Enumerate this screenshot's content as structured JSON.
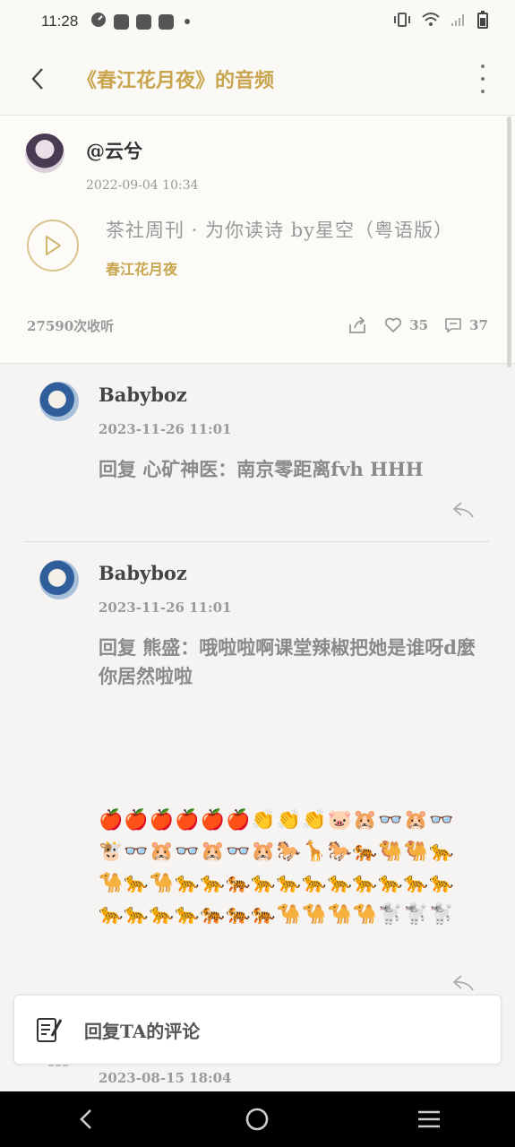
{
  "status_bar": {
    "time": "11:28",
    "icons": [
      "speedometer-icon",
      "mail-icon",
      "mail-icon",
      "mail-icon",
      "dot-icon"
    ],
    "right_icons": [
      "vibrate-icon",
      "wifi-icon",
      "signal-icon",
      "battery-icon"
    ]
  },
  "header": {
    "title": "《春江花月夜》的音频",
    "accent_color": "#c8a54e"
  },
  "post": {
    "user": "@云兮",
    "time": "2022-09-04 10:34",
    "track_title": "茶社周刊 · 为你读诗   by星空（粤语版）",
    "track_sub": "春江花月夜",
    "listen_count": "27590次收听",
    "likes": "35",
    "comments": "37"
  },
  "comments": [
    {
      "user": "Babyboz",
      "time": "2023-11-26 11:01",
      "text": "回复 心矿神医：南京零距离fvh HHH"
    },
    {
      "user": "Babyboz",
      "time": "2023-11-26 11:01",
      "text": "回复 熊盛：哦啦啦啊课堂辣椒把她是谁呀d麼你居然啦啦",
      "emojis": "🍎🍎🍎🍎🍎🍎👏👏👏🐷🐹👓🐹👓🐮👓🐹👓🐹👓🐹🐎🦒🐎🐅🐫🐫🐆🐪🐆🐪🐆🐆🐅🐆🐆🐆🐆🐆🐆🐆🐆🐆🐆🐆🐆🐅🐅🐅🐪🐪🐪🐪🐩🐩🐩"
    }
  ],
  "next_comment_time": "2023-08-15 18:04",
  "reply_bar": {
    "label": "回复TA的评论"
  },
  "nav_bar": [
    "back-icon",
    "home-icon",
    "recents-icon"
  ]
}
